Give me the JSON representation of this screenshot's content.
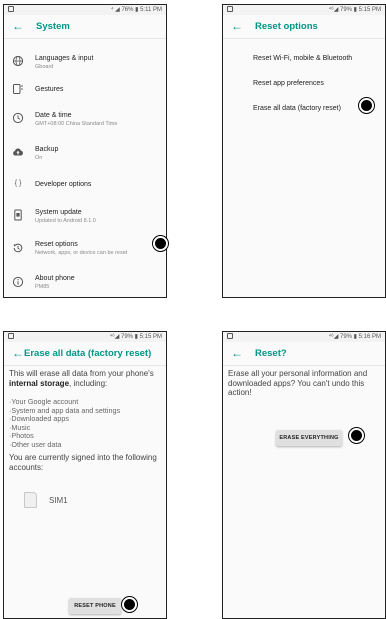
{
  "panel1": {
    "status_right": "⁴ ◢ 76% ▮ 5:11 PM",
    "back_icon": "arrow-left-icon",
    "title": "System",
    "items": [
      {
        "icon": "globe-icon",
        "label": "Languages & input",
        "sub": "Gboard"
      },
      {
        "icon": "gestures-icon",
        "label": "Gestures",
        "sub": ""
      },
      {
        "icon": "clock-icon",
        "label": "Date & time",
        "sub": "GMT+08:00 China Standard Time"
      },
      {
        "icon": "cloud-upload-icon",
        "label": "Backup",
        "sub": "On"
      },
      {
        "icon": "braces-icon",
        "label": "Developer options",
        "sub": ""
      },
      {
        "icon": "phone-update-icon",
        "label": "System update",
        "sub": "Updated to Android 8.1.0"
      },
      {
        "icon": "history-icon",
        "label": "Reset options",
        "sub": "Network, apps, or device can be reset"
      },
      {
        "icon": "info-icon",
        "label": "About phone",
        "sub": "PM85"
      }
    ]
  },
  "panel2": {
    "status_right": "⁴⁶◢ 79% ▮ 5:15 PM",
    "title": "Reset options",
    "options": [
      "Reset Wi-Fi, mobile & Bluetooth",
      "Reset app preferences",
      "Erase all data (factory reset)"
    ]
  },
  "panel3": {
    "status_right": "⁴⁶◢ 79% ▮ 5:15 PM",
    "title": "Erase all data (factory reset)",
    "intro_a": "This will erase all data from your phone's",
    "intro_bold": "internal storage",
    "intro_b": ", including:",
    "list": [
      "·Your Google account",
      "·System and app data and settings",
      "·Downloaded apps",
      "·Music",
      "·Photos",
      "·Other user data"
    ],
    "accounts_text": "You are currently signed into the following accounts:",
    "account_name": "SIM1",
    "button": "RESET PHONE"
  },
  "panel4": {
    "status_right": "⁴⁶◢ 79% ▮ 5:16 PM",
    "title": "Reset?",
    "message": "Erase all your personal information and downloaded apps? You can't undo this action!",
    "button": "ERASE EVERYTHING"
  },
  "colors": {
    "accent": "#009688",
    "text": "#212121",
    "secondary": "#8a8a8a"
  }
}
